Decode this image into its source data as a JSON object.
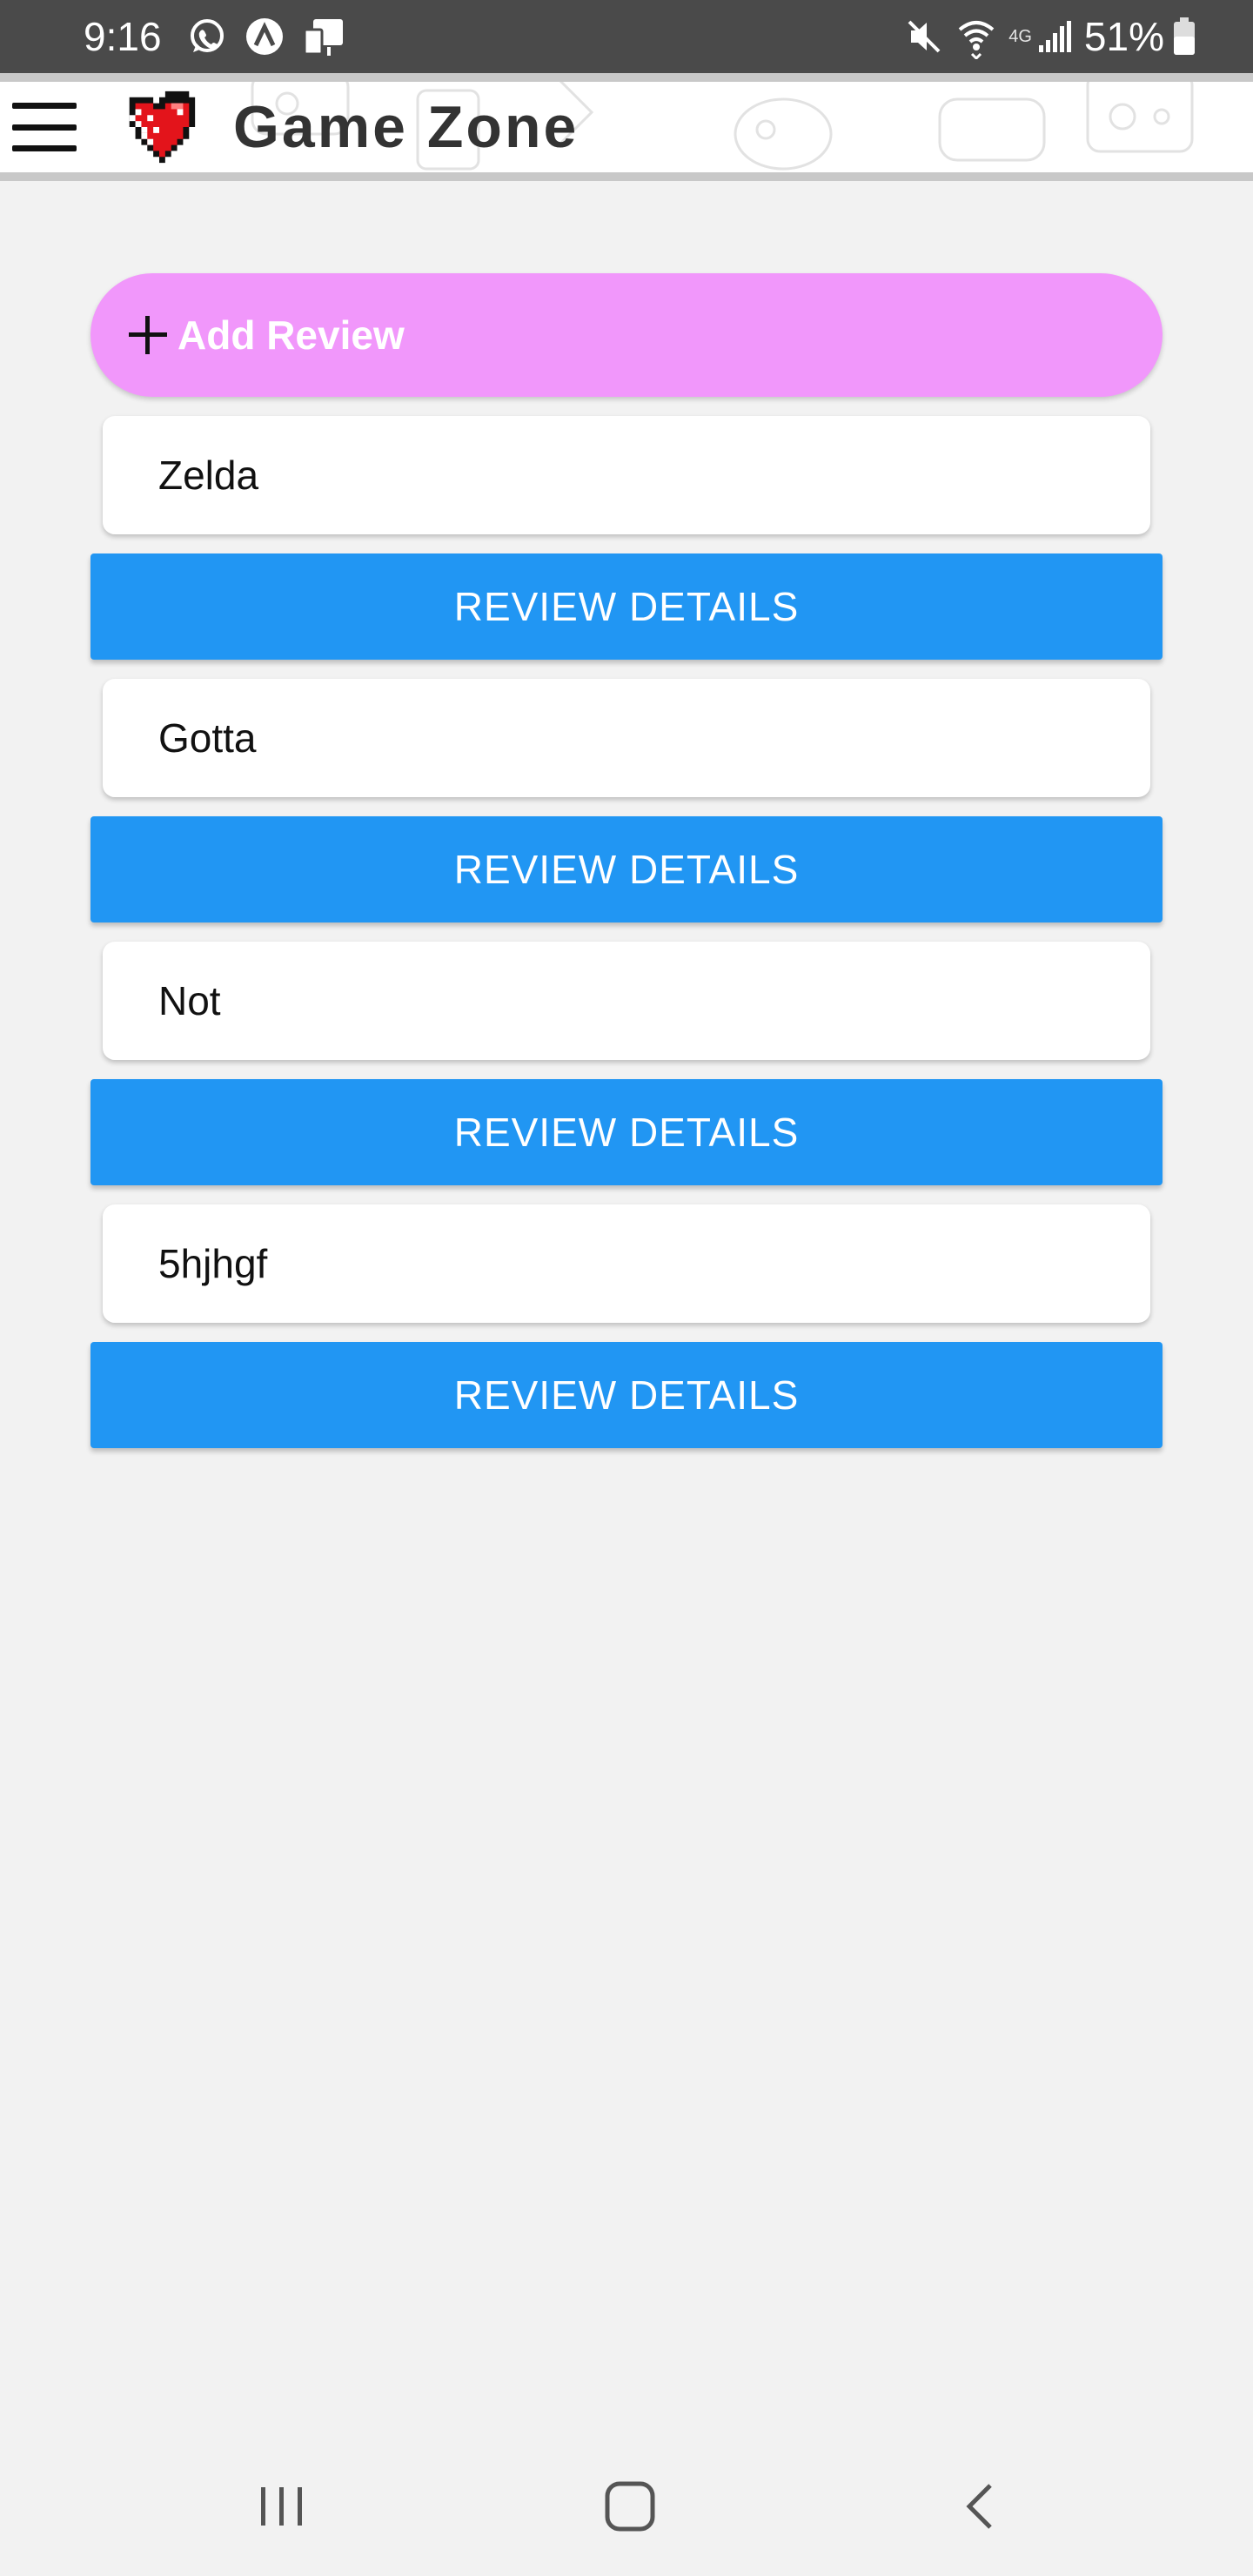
{
  "status_bar": {
    "time": "9:16",
    "network_label": "4G",
    "battery": "51%",
    "icons": [
      "whatsapp-icon",
      "app-icon",
      "cast-icon",
      "mute-icon",
      "wifi-icon",
      "signal-icon",
      "battery-icon"
    ]
  },
  "header": {
    "title": "Game Zone",
    "menu_icon": "menu-icon",
    "logo": "pixel-heart-logo"
  },
  "add_review": {
    "label": "Add Review",
    "icon": "plus-icon",
    "color": "#f197fb"
  },
  "reviews": [
    {
      "title": "Zelda",
      "button_label": "REVIEW DETAILS"
    },
    {
      "title": "Gotta",
      "button_label": "REVIEW DETAILS"
    },
    {
      "title": "Not",
      "button_label": "REVIEW DETAILS"
    },
    {
      "title": "5hjhgf",
      "button_label": "REVIEW DETAILS"
    }
  ],
  "colors": {
    "button": "#2196f3",
    "background": "#f2f2f2",
    "status_bar": "#4a4a4a"
  },
  "nav_bar": [
    "recent-apps-icon",
    "home-icon",
    "back-icon"
  ]
}
